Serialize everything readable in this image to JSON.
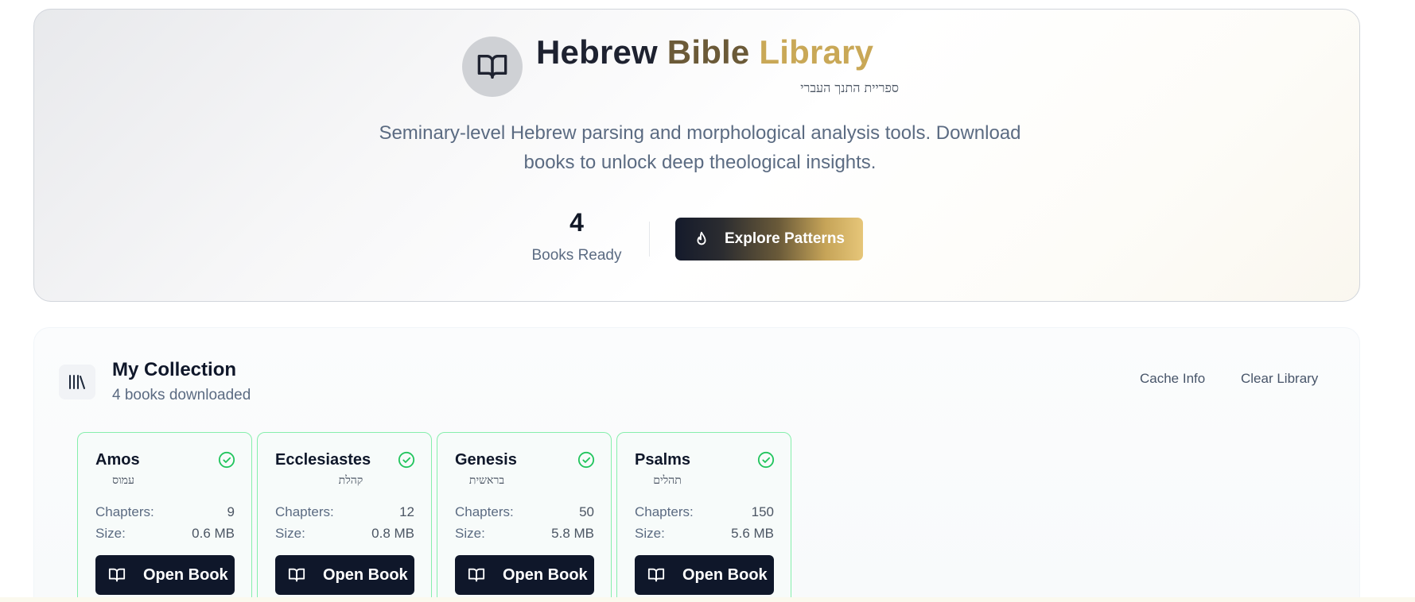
{
  "hero": {
    "title_part1": "Hebrew",
    "title_part2": "Bible",
    "title_part3": "Library",
    "subtitle_hebrew": "ספריית התנך העברי",
    "description_line1": "Seminary-level Hebrew parsing and morphological analysis tools. Download",
    "description_line2": "books to unlock deep theological insights.",
    "stat_value": "4",
    "stat_label": "Books Ready",
    "explore_label": "Explore Patterns",
    "logo_icon": "open-book-icon",
    "explore_icon": "flame-icon"
  },
  "collection": {
    "title": "My Collection",
    "subtitle": "4 books downloaded",
    "icon": "library-icon",
    "cache_info_label": "Cache Info",
    "clear_library_label": "Clear Library",
    "chapters_label": "Chapters:",
    "size_label": "Size:",
    "open_label": "Open Book",
    "books": [
      {
        "name": "Amos",
        "hebrew": "עמוס",
        "chapters": "9",
        "size": "0.6 MB"
      },
      {
        "name": "Ecclesiastes",
        "hebrew": "קהלת",
        "chapters": "12",
        "size": "0.8 MB"
      },
      {
        "name": "Genesis",
        "hebrew": "בראשית",
        "chapters": "50",
        "size": "5.8 MB"
      },
      {
        "name": "Psalms",
        "hebrew": "תהלים",
        "chapters": "150",
        "size": "5.6 MB"
      }
    ]
  },
  "colors": {
    "accent_gold": "#c9a857",
    "dark_navy": "#0f172a",
    "success_green": "#22c55e"
  }
}
